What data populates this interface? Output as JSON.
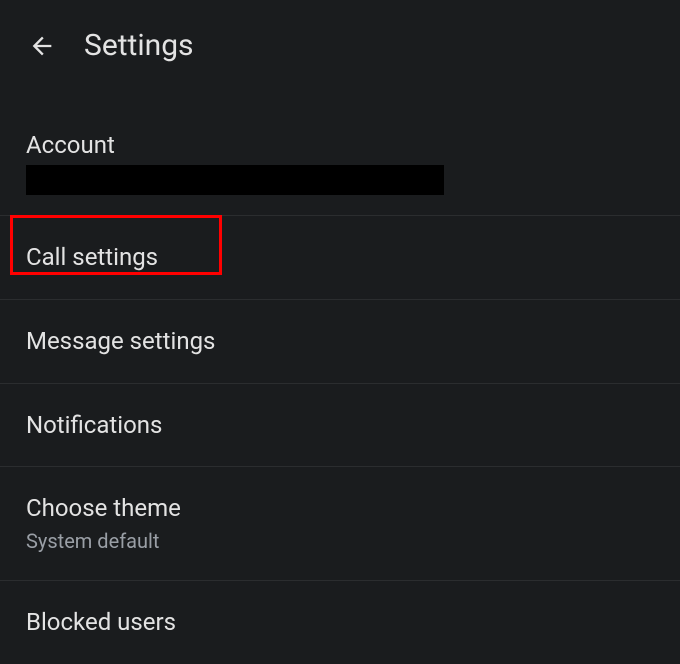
{
  "header": {
    "title": "Settings"
  },
  "account": {
    "label": "Account"
  },
  "items": [
    {
      "title": "Call settings",
      "subtitle": null
    },
    {
      "title": "Message settings",
      "subtitle": null
    },
    {
      "title": "Notifications",
      "subtitle": null
    },
    {
      "title": "Choose theme",
      "subtitle": "System default"
    },
    {
      "title": "Blocked users",
      "subtitle": null
    }
  ]
}
